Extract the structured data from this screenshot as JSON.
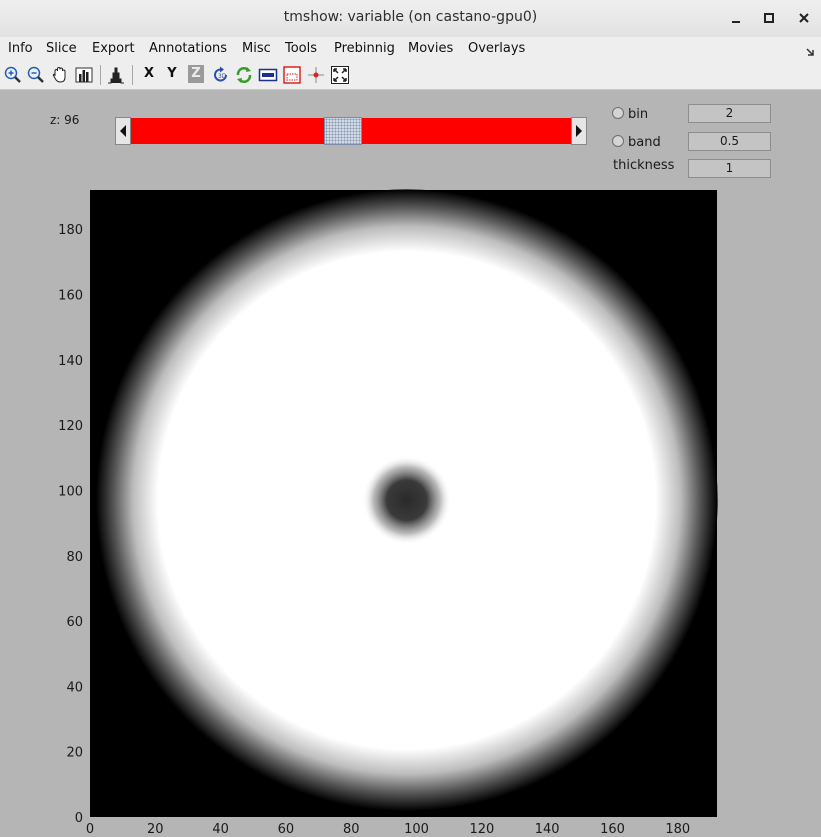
{
  "window": {
    "title": "tmshow: variable (on castano-gpu0)"
  },
  "menu": {
    "items": [
      "Info",
      "Slice",
      "Export",
      "Annotations",
      "Misc",
      "Tools",
      "Prebinnig",
      "Movies",
      "Overlays"
    ]
  },
  "toolbar": {
    "x_label": "X",
    "y_label": "Y",
    "z_label": "Z",
    "icons": [
      "zoom-in-icon",
      "zoom-out-icon",
      "pan-hand-icon",
      "colorbar-icon",
      "histogram-icon",
      "axis-x-button",
      "axis-y-button",
      "axis-z-button",
      "rotate-icon",
      "refresh-icon",
      "ruler-icon",
      "crop-icon",
      "crosshair-icon",
      "fit-window-icon"
    ]
  },
  "slice": {
    "z_text": "z: 96",
    "position_fraction": 0.48,
    "track_color": "#ff0000"
  },
  "options": {
    "bin_label": "bin",
    "bin_value": "2",
    "band_label": "band",
    "band_value": "0.5",
    "thickness_label": "thickness",
    "thickness_value": "1"
  },
  "chart_data": {
    "type": "heatmap",
    "colormap": "gray",
    "xlim": [
      0,
      192
    ],
    "ylim": [
      0,
      192
    ],
    "x_ticks": [
      "0",
      "20",
      "40",
      "60",
      "80",
      "100",
      "120",
      "140",
      "160",
      "180"
    ],
    "y_ticks": [
      "0",
      "20",
      "40",
      "60",
      "80",
      "100",
      "120",
      "140",
      "160",
      "180"
    ],
    "features": [
      {
        "shape": "disk",
        "cx": 97,
        "cy": 97,
        "r": 85,
        "value": "white"
      },
      {
        "shape": "spot",
        "cx": 97,
        "cy": 97,
        "r": 8,
        "value": "dark"
      }
    ]
  }
}
